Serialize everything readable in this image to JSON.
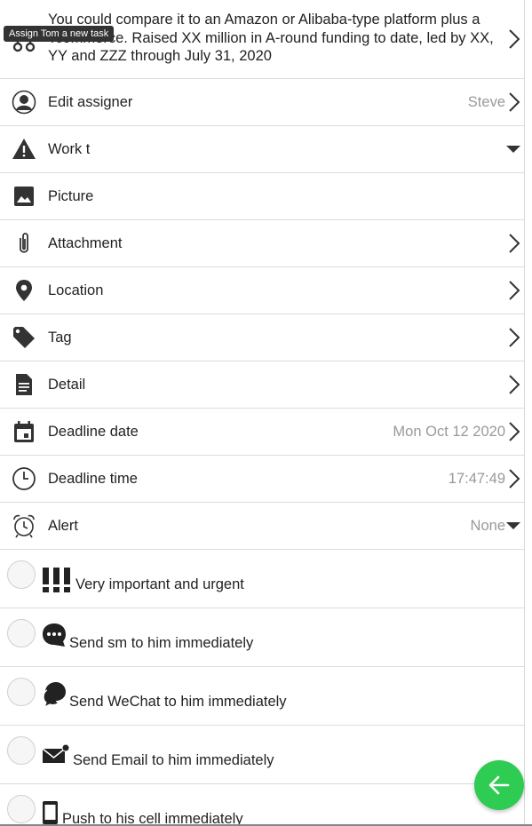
{
  "description": {
    "text": "You could compare it to an Amazon or Alibaba-type platform plus a Tcommerce. Raised XX million in A-round funding to date, led by XX, YY and ZZZ through July 31, 2020",
    "icon": "link-icon"
  },
  "tooltip": "Assign Tom a new task",
  "rows": {
    "assigner": {
      "label": "Edit assigner",
      "value": "Steve",
      "icon": "person-icon"
    },
    "work_type": {
      "label": "Work t",
      "icon": "warning-icon"
    },
    "picture": {
      "label": "Picture",
      "icon": "image-icon"
    },
    "attachment": {
      "label": "Attachment",
      "icon": "paperclip-icon"
    },
    "location": {
      "label": "Location",
      "icon": "map-pin-icon"
    },
    "tag": {
      "label": "Tag",
      "icon": "tag-icon"
    },
    "detail": {
      "label": "Detail",
      "icon": "document-icon"
    },
    "deadline_date": {
      "label": "Deadline date",
      "value": "Mon Oct 12 2020",
      "icon": "calendar-icon"
    },
    "deadline_time": {
      "label": "Deadline time",
      "value": "17:47:49",
      "icon": "clock-icon"
    },
    "alert": {
      "label": "Alert",
      "value": "None",
      "icon": "alarm-clock-icon"
    }
  },
  "options": [
    {
      "label": "Very important and urgent",
      "icon": "exclamation-icon",
      "checked": false
    },
    {
      "label": "Send sm to him immediately",
      "icon": "chat-bubble-icon",
      "checked": false
    },
    {
      "label": "Send WeChat to him immediately",
      "icon": "wechat-icon",
      "checked": false
    },
    {
      "label": "Send Email to him immediately",
      "icon": "email-icon",
      "checked": false
    },
    {
      "label": "Push to his cell immediately",
      "icon": "phone-icon",
      "checked": false
    }
  ],
  "fab": {
    "icon": "arrow-left-icon",
    "color": "#2ecc52"
  }
}
